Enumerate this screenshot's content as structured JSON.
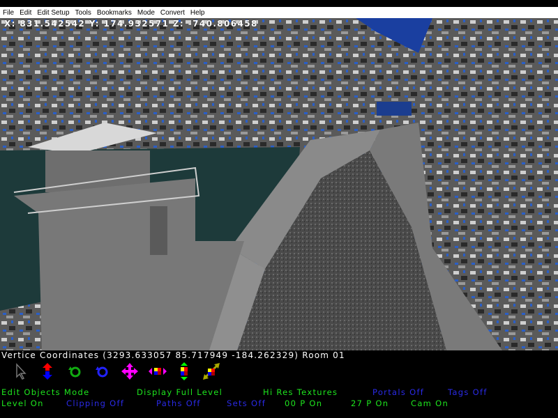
{
  "menu": [
    "File",
    "Edit",
    "Edit Setup",
    "Tools",
    "Bookmarks",
    "Mode",
    "Convert",
    "Help"
  ],
  "coordinates_readout": "X: 831.542542 Y: 174.932571 Z: -740.806458",
  "vertice_line": "Vertice Coordinates (3293.633057 85.717949 -184.262329) Room 01",
  "toolbar_icons": [
    "select-arrow-icon",
    "move-vertical-icon",
    "rotate-green-icon",
    "rotate-blue-icon",
    "move-all-directions-icon",
    "scale-horizontal-icon",
    "scale-vertical-icon",
    "scale-diagonal-icon"
  ],
  "status_row1": [
    {
      "label": "Edit Objects Mode",
      "color": "#1ee61e"
    },
    {
      "label": "Display Full Level",
      "color": "#1ee61e"
    },
    {
      "label": "Hi Res Textures",
      "color": "#1ee61e"
    },
    {
      "label": "Portals Off",
      "color": "#2a2ae6"
    },
    {
      "label": "Tags Off",
      "color": "#2a2ae6"
    }
  ],
  "status_row2": [
    {
      "label": "Level On",
      "color": "#1ee61e"
    },
    {
      "label": "Clipping Off",
      "color": "#2a2ae6"
    },
    {
      "label": "Paths Off",
      "color": "#2a2ae6"
    },
    {
      "label": "Sets Off",
      "color": "#2a2ae6"
    },
    {
      "label": "00 P On",
      "color": "#1ee61e"
    },
    {
      "label": "27 P On",
      "color": "#1ee61e"
    },
    {
      "label": "Cam On",
      "color": "#1ee61e"
    }
  ]
}
